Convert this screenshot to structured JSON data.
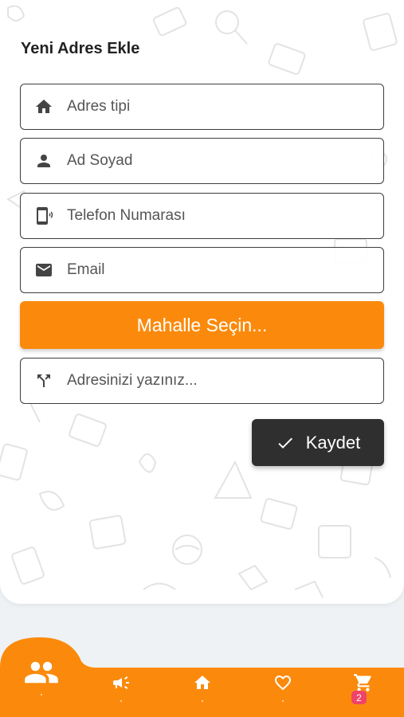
{
  "form": {
    "title": "Yeni Adres Ekle",
    "fields": {
      "address_type": {
        "placeholder": "Adres tipi",
        "value": "",
        "icon": "home-icon"
      },
      "full_name": {
        "placeholder": "Ad Soyad",
        "value": "",
        "icon": "person-icon"
      },
      "phone": {
        "placeholder": "Telefon Numarası",
        "value": "",
        "icon": "phone-icon"
      },
      "email": {
        "placeholder": "Email",
        "value": "",
        "icon": "mail-icon"
      },
      "address": {
        "placeholder": "Adresinizi yazınız...",
        "value": "",
        "icon": "directions-icon"
      }
    },
    "neighborhood_button": "Mahalle Seçin...",
    "save_button": "Kaydet"
  },
  "bottom_nav": {
    "items": [
      {
        "icon": "group-icon",
        "active": true
      },
      {
        "icon": "megaphone-icon"
      },
      {
        "icon": "home-icon"
      },
      {
        "icon": "heart-icon"
      },
      {
        "icon": "cart-icon",
        "badge": "2"
      }
    ]
  },
  "colors": {
    "accent": "#fb8a0c",
    "dark_button": "#2f2f2f",
    "badge": "#f0436a"
  }
}
